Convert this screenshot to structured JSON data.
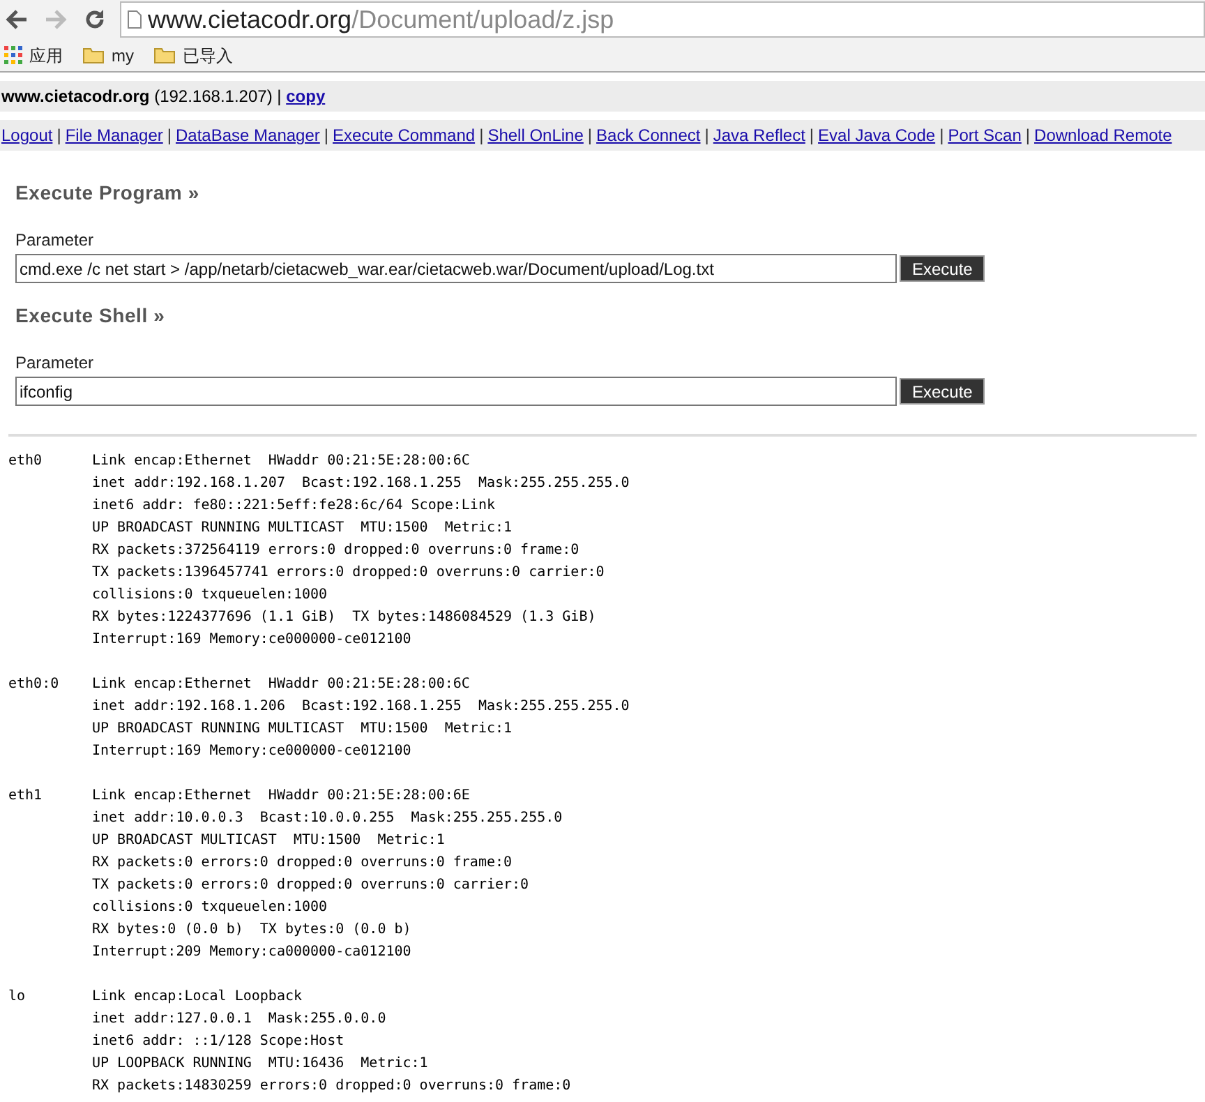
{
  "browser": {
    "url_host": "www.cietacodr.org",
    "url_path": "/Document/upload/z.jsp",
    "bookmarks": [
      {
        "kind": "apps",
        "label": "应用"
      },
      {
        "kind": "folder",
        "label": "my"
      },
      {
        "kind": "folder",
        "label": "已导入"
      }
    ]
  },
  "header": {
    "host": "www.cietacodr.org",
    "ip_open": " (",
    "ip": "192.168.1.207",
    "ip_close": ") | ",
    "link": "copy"
  },
  "nav": [
    {
      "kind": "link",
      "text": "Logout"
    },
    {
      "kind": "separator",
      "text": "|"
    },
    {
      "kind": "link",
      "text": "File Manager"
    },
    {
      "kind": "separator",
      "text": "|"
    },
    {
      "kind": "link",
      "text": "DataBase Manager"
    },
    {
      "kind": "separator",
      "text": "|"
    },
    {
      "kind": "link",
      "text": "Execute Command"
    },
    {
      "kind": "separator",
      "text": "|"
    },
    {
      "kind": "link",
      "text": "Shell OnLine"
    },
    {
      "kind": "separator",
      "text": "|"
    },
    {
      "kind": "link",
      "text": "Back Connect"
    },
    {
      "kind": "separator",
      "text": "|"
    },
    {
      "kind": "link",
      "text": "Java Reflect"
    },
    {
      "kind": "separator",
      "text": "|"
    },
    {
      "kind": "link",
      "text": "Eval Java Code"
    },
    {
      "kind": "separator",
      "text": "|"
    },
    {
      "kind": "link",
      "text": "Port Scan"
    },
    {
      "kind": "separator",
      "text": "|"
    },
    {
      "kind": "link",
      "text": "Download Remote"
    }
  ],
  "sections": [
    {
      "title": "Execute Program »",
      "label": "Parameter",
      "value": "cmd.exe /c net start > /app/netarb/cietacweb_war.ear/cietacweb.war/Document/upload/Log.txt",
      "button": "Execute"
    },
    {
      "title": "Execute Shell »",
      "label": "Parameter",
      "value": "ifconfig",
      "button": "Execute"
    }
  ],
  "output": [
    {
      "name": "eth0",
      "lines": [
        "Link encap:Ethernet  HWaddr 00:21:5E:28:00:6C",
        "inet addr:192.168.1.207  Bcast:192.168.1.255  Mask:255.255.255.0",
        "inet6 addr: fe80::221:5eff:fe28:6c/64 Scope:Link",
        "UP BROADCAST RUNNING MULTICAST  MTU:1500  Metric:1",
        "RX packets:372564119 errors:0 dropped:0 overruns:0 frame:0",
        "TX packets:1396457741 errors:0 dropped:0 overruns:0 carrier:0",
        "collisions:0 txqueuelen:1000",
        "RX bytes:1224377696 (1.1 GiB)  TX bytes:1486084529 (1.3 GiB)",
        "Interrupt:169 Memory:ce000000-ce012100"
      ]
    },
    {
      "name": "eth0:0",
      "lines": [
        "Link encap:Ethernet  HWaddr 00:21:5E:28:00:6C",
        "inet addr:192.168.1.206  Bcast:192.168.1.255  Mask:255.255.255.0",
        "UP BROADCAST RUNNING MULTICAST  MTU:1500  Metric:1",
        "Interrupt:169 Memory:ce000000-ce012100"
      ]
    },
    {
      "name": "eth1",
      "lines": [
        "Link encap:Ethernet  HWaddr 00:21:5E:28:00:6E",
        "inet addr:10.0.0.3  Bcast:10.0.0.255  Mask:255.255.255.0",
        "UP BROADCAST MULTICAST  MTU:1500  Metric:1",
        "RX packets:0 errors:0 dropped:0 overruns:0 frame:0",
        "TX packets:0 errors:0 dropped:0 overruns:0 carrier:0",
        "collisions:0 txqueuelen:1000",
        "RX bytes:0 (0.0 b)  TX bytes:0 (0.0 b)",
        "Interrupt:209 Memory:ca000000-ca012100"
      ]
    },
    {
      "name": "lo",
      "lines": [
        "Link encap:Local Loopback",
        "inet addr:127.0.0.1  Mask:255.0.0.0",
        "inet6 addr: ::1/128 Scope:Host",
        "UP LOOPBACK RUNNING  MTU:16436  Metric:1",
        "RX packets:14830259 errors:0 dropped:0 overruns:0 frame:0"
      ]
    }
  ]
}
